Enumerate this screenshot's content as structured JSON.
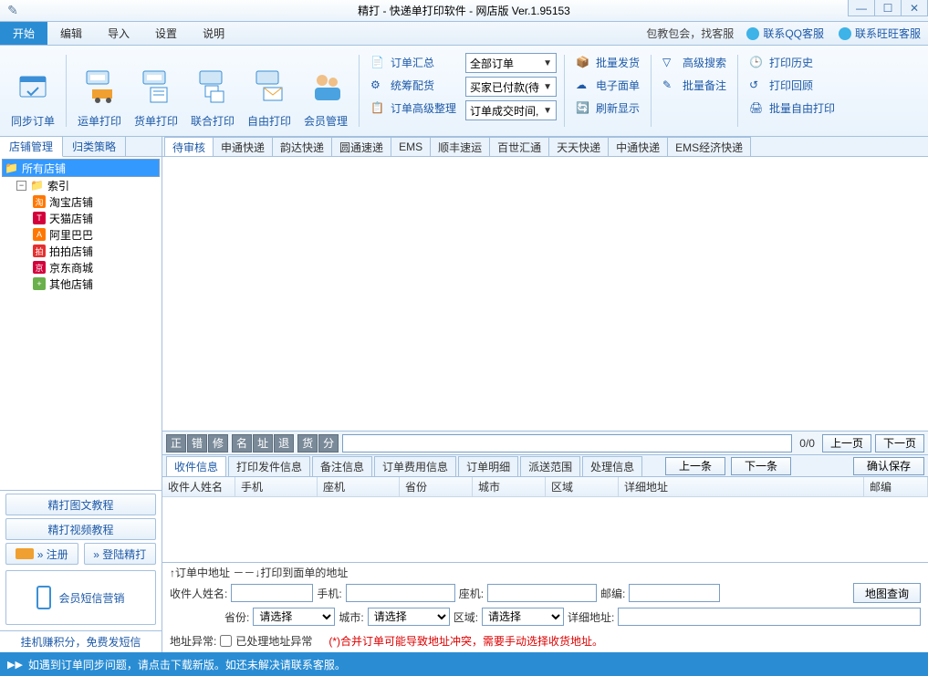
{
  "title": "精打 - 快递单打印软件 - 网店版 Ver.1.95153",
  "menu": {
    "start": "开始",
    "edit": "编辑",
    "import": "导入",
    "settings": "设置",
    "help": "说明"
  },
  "menur": {
    "train": "包教包会，找客服",
    "qq": "联系QQ客服",
    "ww": "联系旺旺客服"
  },
  "ribbon": {
    "sync": "同步订单",
    "ship": "运单打印",
    "goods": "货单打印",
    "joint": "联合打印",
    "free": "自由打印",
    "member": "会员管理",
    "sum": "订单汇总",
    "plan": "统筹配货",
    "adv": "订单高级整理",
    "dd_all": "全部订单",
    "dd_paid": "买家已付款(待",
    "dd_time": "订单成交时间,",
    "bulk": "批量发货",
    "eface": "电子面单",
    "refresh": "刷新显示",
    "search": "高级搜索",
    "remark": "批量备注",
    "hist": "打印历史",
    "review": "打印回顾",
    "bulkfree": "批量自由打印"
  },
  "left": {
    "tab1": "店铺管理",
    "tab2": "归类策略",
    "root": "所有店铺",
    "idx": "索引",
    "shops": {
      "taobao": "淘宝店铺",
      "tmall": "天猫店铺",
      "ali": "阿里巴巴",
      "paipai": "拍拍店铺",
      "jd": "京东商城",
      "other": "其他店铺"
    },
    "btn1": "精打图文教程",
    "btn2": "精打视频教程",
    "reg": "» 注册",
    "login": "» 登陆精打",
    "sms": "会员短信营销",
    "foot": "挂机赚积分，免费发短信"
  },
  "tabs": [
    "待审核",
    "申通快递",
    "韵达快递",
    "圆通速递",
    "EMS",
    "顺丰速运",
    "百世汇通",
    "天天快递",
    "中通快递",
    "EMS经济快递"
  ],
  "act": {
    "a1": "正",
    "a2": "错",
    "a3": "修",
    "b1": "名",
    "b2": "址",
    "b3": "退",
    "c1": "货",
    "c2": "分"
  },
  "pager": {
    "info": "0/0",
    "prev": "上一页",
    "next": "下一页"
  },
  "dtabs": [
    "收件信息",
    "打印发件信息",
    "备注信息",
    "订单费用信息",
    "订单明细",
    "派送范围",
    "处理信息"
  ],
  "nav": {
    "prev": "上一条",
    "next": "下一条",
    "save": "确认保存"
  },
  "cols": {
    "name": "收件人姓名",
    "mobile": "手机",
    "tel": "座机",
    "prov": "省份",
    "city": "城市",
    "area": "区域",
    "addr": "详细地址",
    "zip": "邮编"
  },
  "tip": "↑订单中地址 －－↓打印到面单的地址",
  "form": {
    "name": "收件人姓名:",
    "mobile": "手机:",
    "tel": "座机:",
    "zip": "邮编:",
    "map": "地图查询",
    "prov": "省份:",
    "city": "城市:",
    "area": "区域:",
    "addr": "详细地址:",
    "sel": "请选择",
    "abn": "地址异常:",
    "chk": "已处理地址异常",
    "warn": "(*)合并订单可能导致地址冲突，需要手动选择收货地址。"
  },
  "status": "如遇到订单同步问题，请点击下载新版。如还未解决请联系客服。"
}
